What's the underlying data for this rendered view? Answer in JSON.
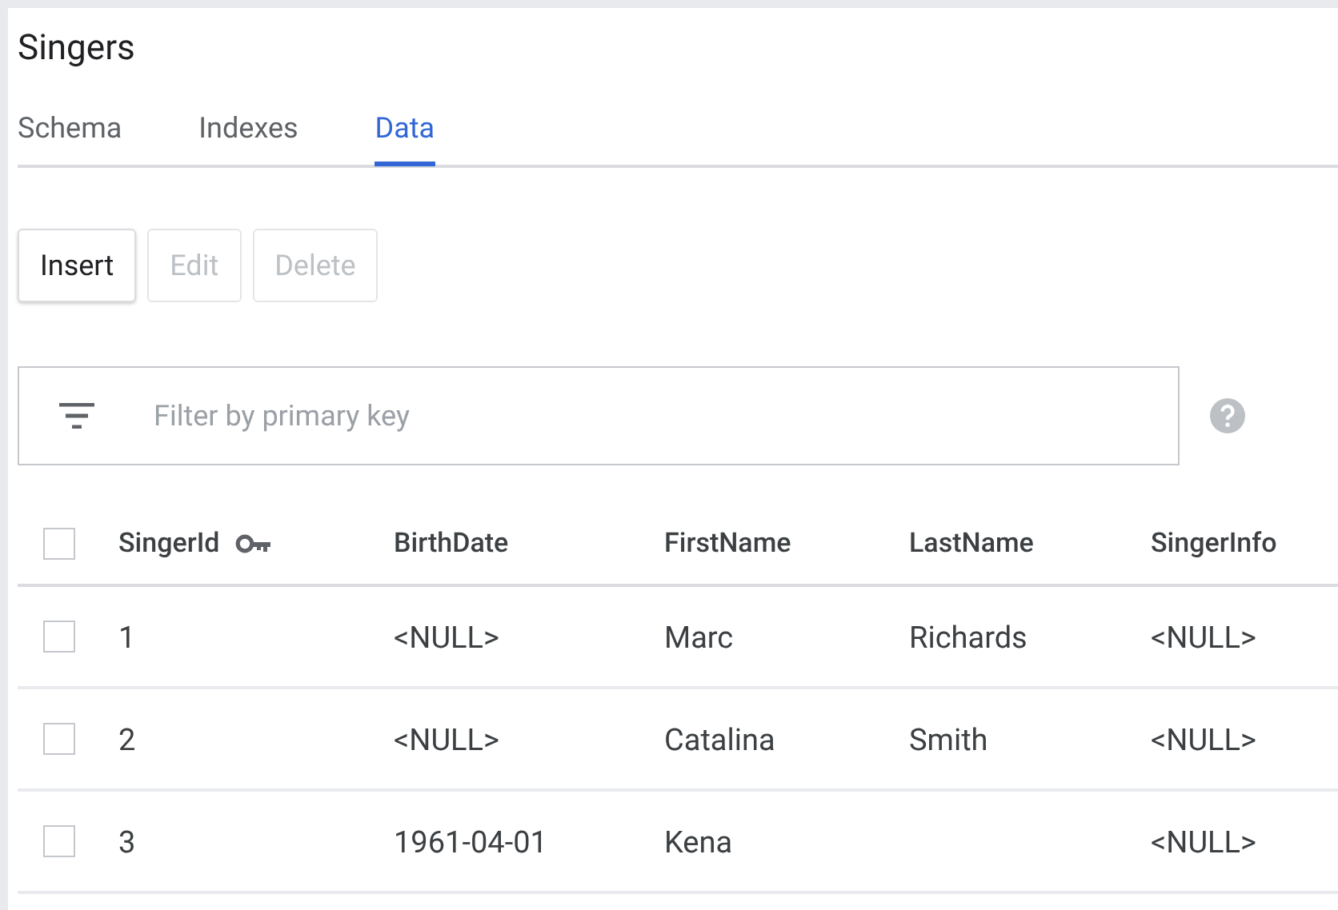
{
  "title": "Singers",
  "tabs": [
    {
      "label": "Schema",
      "selected": false
    },
    {
      "label": "Indexes",
      "selected": false
    },
    {
      "label": "Data",
      "selected": true
    }
  ],
  "buttons": [
    {
      "label": "Insert",
      "disabled": false
    },
    {
      "label": "Edit",
      "disabled": true
    },
    {
      "label": "Delete",
      "disabled": true
    }
  ],
  "filter": {
    "placeholder": "Filter by primary key"
  },
  "table": {
    "header_checked": false,
    "columns": [
      {
        "label": "SingerId",
        "kind": "key"
      },
      {
        "label": "BirthDate",
        "kind": "plain"
      },
      {
        "label": "FirstName",
        "kind": "plain"
      },
      {
        "label": "LastName",
        "kind": "plain"
      },
      {
        "label": "SingerInfo",
        "kind": "plain"
      }
    ],
    "rows": [
      {
        "checked": false,
        "cells": [
          "1",
          "<NULL>",
          "Marc",
          "Richards",
          "<NULL>"
        ]
      },
      {
        "checked": false,
        "cells": [
          "2",
          "<NULL>",
          "Catalina",
          "Smith",
          "<NULL>"
        ]
      },
      {
        "checked": false,
        "cells": [
          "3",
          "1961-04-01",
          "Kena",
          "",
          "<NULL>"
        ]
      }
    ]
  }
}
